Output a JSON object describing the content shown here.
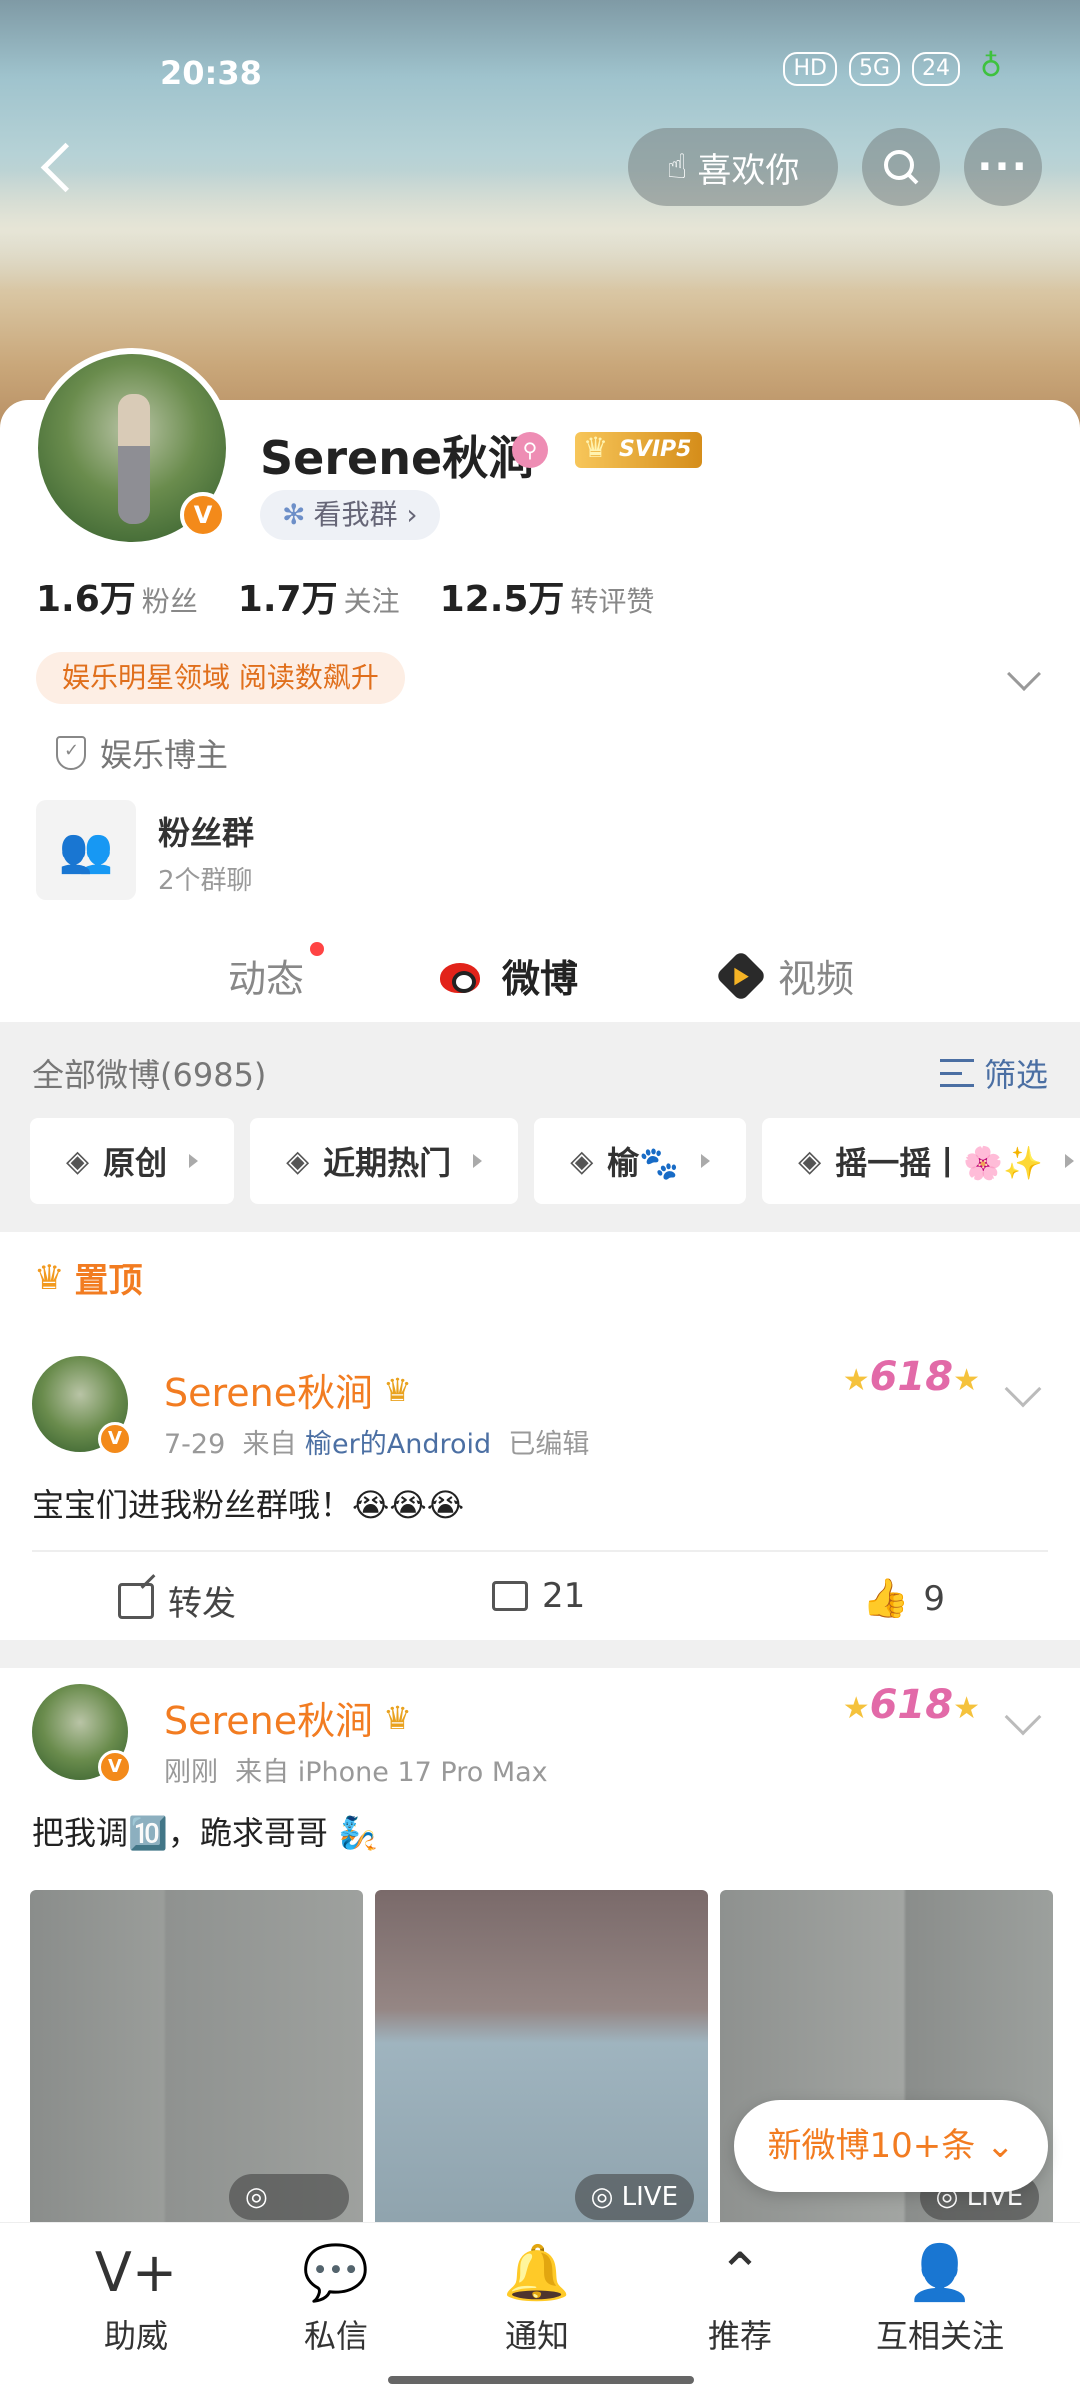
{
  "status": {
    "time": "20:38",
    "battery": "24",
    "icons": [
      "HD",
      "5G"
    ]
  },
  "topbar": {
    "like_label": "喜欢你"
  },
  "profile": {
    "name": "Serene秋涧",
    "vip": "SVIP5",
    "group_btn": "看我群",
    "stats": [
      {
        "value": "1.6万",
        "label": "粉丝"
      },
      {
        "value": "1.7万",
        "label": "关注"
      },
      {
        "value": "12.5万",
        "label": "转评赞"
      }
    ],
    "tag": "娱乐明星领域 阅读数飙升",
    "role": "娱乐博主",
    "fan_group": {
      "title": "粉丝群",
      "sub": "2个群聊"
    }
  },
  "tabs": [
    "动态",
    "微博",
    "视频"
  ],
  "filter": {
    "count": "全部微博(6985)",
    "sift": "筛选",
    "chips": [
      "原创",
      "近期热门",
      "榆🐾",
      "摇一摇丨🌸✨"
    ]
  },
  "pinned_label": "置顶",
  "posts": [
    {
      "name": "Serene秋涧",
      "time": "7-29",
      "from": "来自",
      "source": "榆er的Android",
      "edited": "已编辑",
      "text": "宝宝们进我粉丝群哦！😭😭😭",
      "share": "转发",
      "comments": "21",
      "likes": "9"
    },
    {
      "name": "Serene秋涧",
      "time": "刚刚",
      "from": "来自",
      "source": "iPhone 17 Pro Max",
      "text": "把我调🔟，跪求哥哥 🧞",
      "live": "LIVE"
    }
  ],
  "new_posts": "新微博10+条 ⌄",
  "bottom_nav": [
    "助威",
    "私信",
    "通知",
    "推荐",
    "互相关注"
  ],
  "colors": {
    "accent": "#f27c21",
    "link": "#4b6fa3"
  }
}
